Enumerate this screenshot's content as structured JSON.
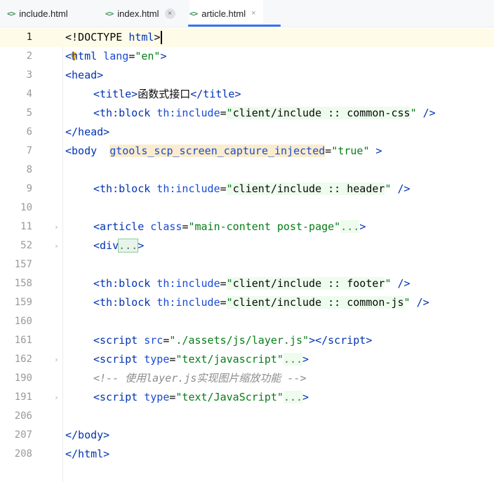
{
  "tabs": [
    {
      "label": "include.html",
      "icon": "html-tag-icon",
      "close": false,
      "active": false
    },
    {
      "label": "index.html",
      "icon": "html-tag-icon",
      "close": true,
      "active": false
    },
    {
      "label": "article.html",
      "icon": "html-tag-icon",
      "close": true,
      "active": true
    }
  ],
  "tab_icon_glyph": "<>",
  "close_glyph": "×",
  "fold_glyph": "›",
  "lines": {
    "l1": {
      "num": "1",
      "decl": "<!DOCTYPE ",
      "name": "html",
      "end": ">"
    },
    "l2": {
      "num": "2",
      "o": "<",
      "tag": "html",
      "attr": " lang",
      "eq": "=",
      "val": "\"en\"",
      "end": ">"
    },
    "l3": {
      "num": "3",
      "text": "<head>"
    },
    "l4": {
      "num": "4",
      "open": "<title>",
      "text": "函数式接口",
      "close": "</title>"
    },
    "l5": {
      "num": "5",
      "open": "<th:block",
      "attr": "th:include",
      "eq": "=",
      "q1": "\"",
      "val": "client/include :: common-css",
      "q2": "\"",
      "end": " />"
    },
    "l6": {
      "num": "6",
      "text": "</head>"
    },
    "l7": {
      "num": "7",
      "open": "<body",
      "attr": "gtools_scp_screen_capture_injected",
      "eq": "=",
      "val": "\"true\"",
      "end": " >"
    },
    "l8": {
      "num": "8"
    },
    "l9": {
      "num": "9",
      "open": "<th:block",
      "attr": "th:include",
      "eq": "=",
      "q1": "\"",
      "val": "client/include :: header",
      "q2": "\"",
      "end": " />"
    },
    "l10": {
      "num": "10"
    },
    "l11": {
      "num": "11",
      "open": "<article",
      "attr": " class",
      "eq": "=",
      "val": "\"main-content post-page\"",
      "dots": "...",
      "end": ">"
    },
    "l52": {
      "num": "52",
      "open": "<div",
      "dots": "...",
      "end": ">"
    },
    "l157": {
      "num": "157"
    },
    "l158": {
      "num": "158",
      "open": "<th:block",
      "attr": "th:include",
      "eq": "=",
      "q1": "\"",
      "val": "client/include :: footer",
      "q2": "\"",
      "end": " />"
    },
    "l159": {
      "num": "159",
      "open": "<th:block",
      "attr": "th:include",
      "eq": "=",
      "q1": "\"",
      "val": "client/include :: common-js",
      "q2": "\"",
      "end": " />"
    },
    "l160": {
      "num": "160"
    },
    "l161": {
      "num": "161",
      "open": "<script",
      "attr": " src",
      "eq": "=",
      "val": "\"./assets/js/layer.js\"",
      "mid": ">",
      "close": "</script",
      "end": ">"
    },
    "l162": {
      "num": "162",
      "open": "<script",
      "attr": " type",
      "eq": "=",
      "val": "\"text/javascript\"",
      "dots": "...",
      "end": ">"
    },
    "l190": {
      "num": "190",
      "comment": "<!-- 使用layer.js实现图片缩放功能 -->"
    },
    "l191": {
      "num": "191",
      "open": "<script",
      "attr": " type",
      "eq": "=",
      "val": "\"text/JavaScript\"",
      "dots": "...",
      "end": ">"
    },
    "l206": {
      "num": "206"
    },
    "l207": {
      "num": "207",
      "text": "</body>"
    },
    "l208": {
      "num": "208",
      "text": "</html>"
    }
  },
  "colors": {
    "tag": "#0033b3",
    "attr": "#174ad4",
    "string": "#067d17",
    "comment": "#8c8c8c",
    "active_tab_underline": "#3574f0"
  }
}
